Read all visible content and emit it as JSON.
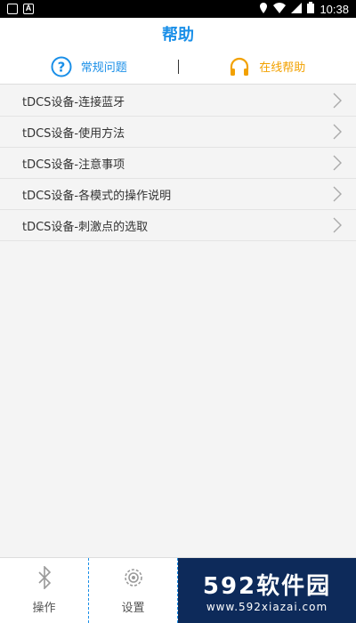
{
  "status": {
    "time": "10:38"
  },
  "header": {
    "title": "帮助"
  },
  "tabs": [
    {
      "label": "常规问题",
      "icon": "question-icon"
    },
    {
      "label": "在线帮助",
      "icon": "headphones-icon"
    }
  ],
  "list": [
    {
      "label": "tDCS设备-连接蓝牙"
    },
    {
      "label": "tDCS设备-使用方法"
    },
    {
      "label": "tDCS设备-注意事项"
    },
    {
      "label": "tDCS设备-各模式的操作说明"
    },
    {
      "label": "tDCS设备-刺激点的选取"
    }
  ],
  "bottom_nav": [
    {
      "label": "操作",
      "icon": "bluetooth-icon"
    },
    {
      "label": "设置",
      "icon": "gear-icon"
    }
  ],
  "watermark": {
    "brand": "592软件园",
    "url": "www.592xiazai.com"
  }
}
